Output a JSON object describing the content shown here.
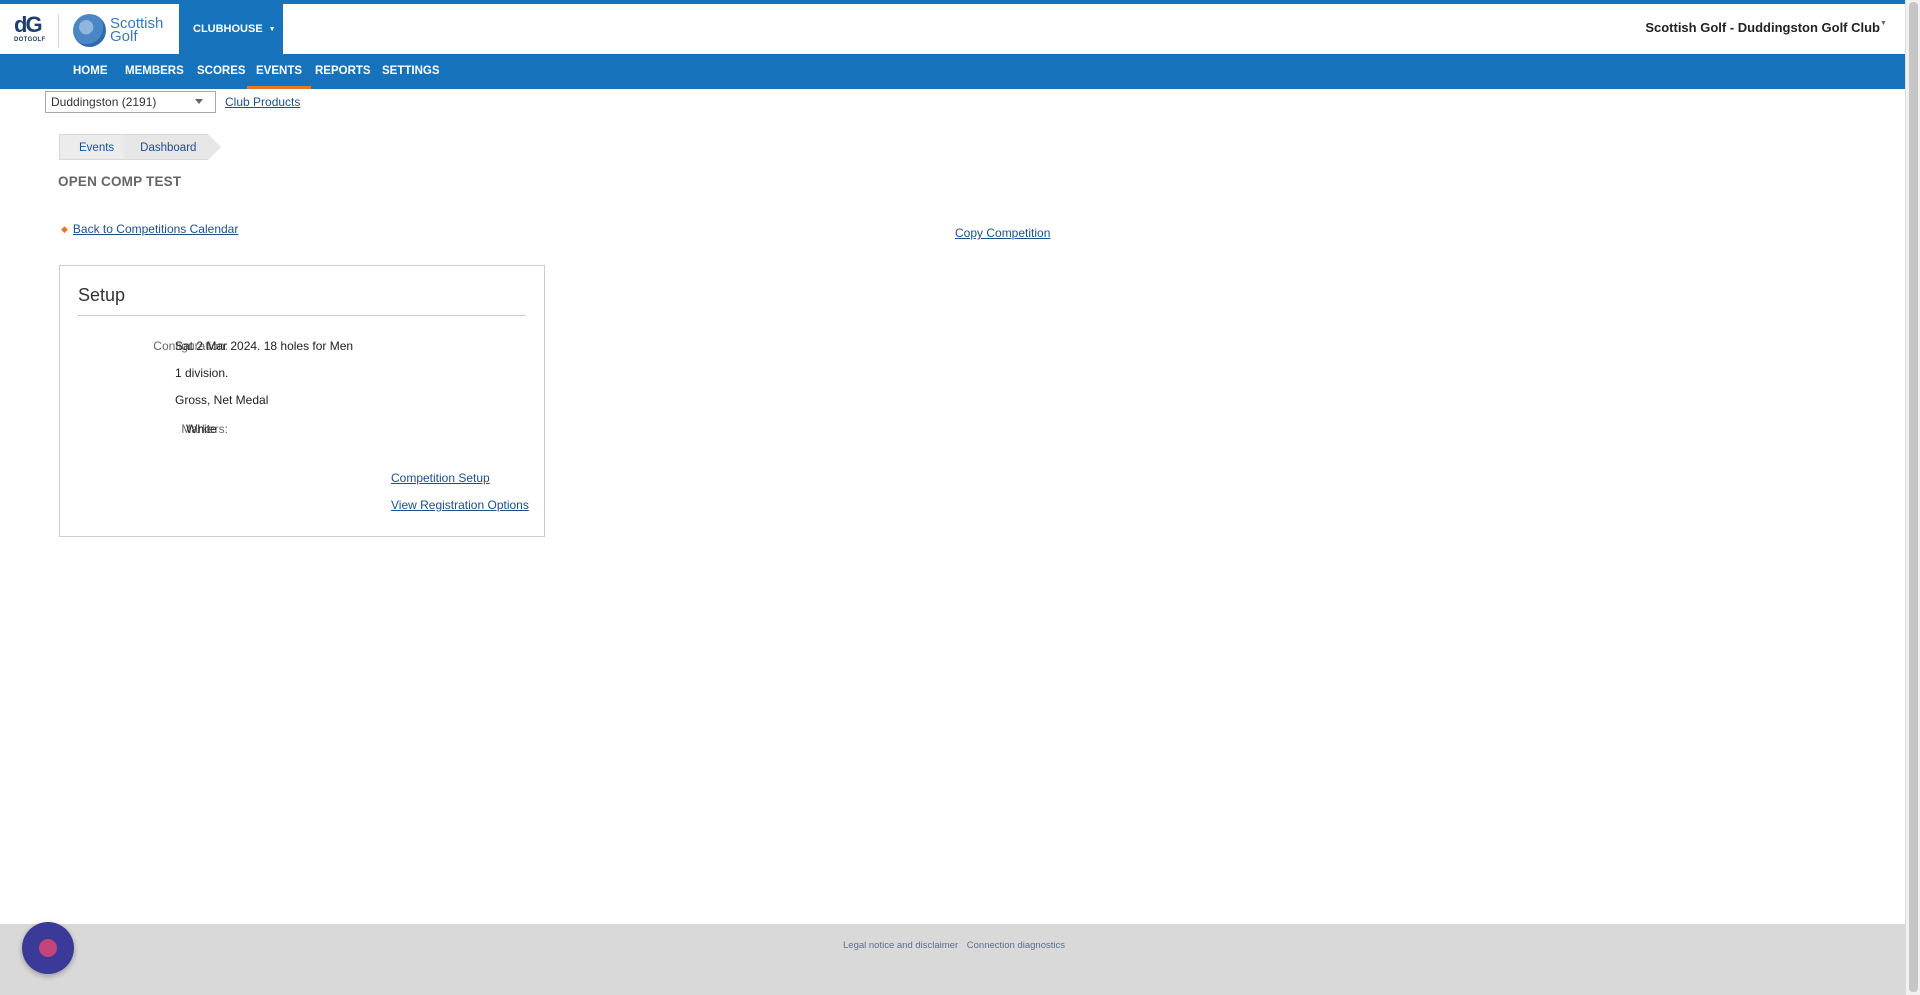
{
  "brand": {
    "dotgolf_mark": "dG",
    "dotgolf_text": "DOTGOLF",
    "scottish_golf_line1": "Scottish",
    "scottish_golf_line2": "Golf"
  },
  "header": {
    "app_menu_label": "CLUBHOUSE",
    "account_label": "Scottish Golf - Duddingston Golf Club"
  },
  "nav": {
    "items": [
      {
        "label": "HOME"
      },
      {
        "label": "MEMBERS"
      },
      {
        "label": "SCORES"
      },
      {
        "label": "EVENTS",
        "active": true
      },
      {
        "label": "REPORTS"
      },
      {
        "label": "SETTINGS"
      }
    ]
  },
  "club_selector": {
    "selected": "Duddingston (2191)"
  },
  "club_products_link": "Club Products",
  "breadcrumb": {
    "items": [
      "Events",
      "Dashboard"
    ]
  },
  "page_title": "OPEN COMP TEST",
  "back_link": "Back to Competitions Calendar",
  "copy_competition_link": "Copy Competition",
  "setup_panel": {
    "title": "Setup",
    "configuration_label": "Configuration:",
    "configuration_lines": [
      "Sat 2 Mar 2024. 18 holes for Men",
      "1 division.",
      "Gross, Net Medal"
    ],
    "markers_label": "Markers:",
    "markers_value": "White",
    "competition_setup_link": "Competition Setup",
    "view_registration_link": "View Registration Options"
  },
  "footer": {
    "links": [
      "Legal notice and disclaimer",
      "Connection diagnostics"
    ]
  },
  "colors": {
    "primary_blue": "#1572bb",
    "active_accent": "#e87722",
    "link": "#1d4f8c",
    "footer_bg": "#d9d9d9",
    "chat_bubble": "#3b3a98"
  },
  "icons": {
    "back": "left-arrow-icon",
    "chat": "chat-widget-icon"
  }
}
